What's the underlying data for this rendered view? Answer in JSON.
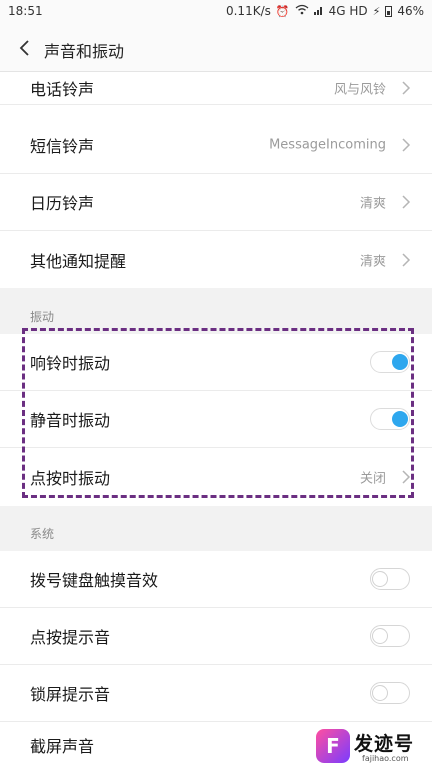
{
  "status_bar": {
    "time": "18:51",
    "speed": "0.11K/s",
    "network": "4G HD",
    "battery": "46%",
    "icons": [
      "alarm-icon",
      "wifi-icon",
      "signal-icon",
      "charging-icon",
      "battery-icon"
    ]
  },
  "header": {
    "title": "声音和振动",
    "back_icon": "chevron-left-icon"
  },
  "ringtones": [
    {
      "label": "电话铃声",
      "value": "风与风铃"
    },
    {
      "label": "短信铃声",
      "value": "MessageIncoming"
    },
    {
      "label": "日历铃声",
      "value": "清爽"
    },
    {
      "label": "其他通知提醒",
      "value": "清爽"
    }
  ],
  "vibration": {
    "title": "振动",
    "items": [
      {
        "label": "响铃时振动",
        "toggle": true
      },
      {
        "label": "静音时振动",
        "toggle": true
      },
      {
        "label": "点按时振动",
        "value": "关闭"
      }
    ]
  },
  "system": {
    "title": "系统",
    "items": [
      {
        "label": "拨号键盘触摸音效",
        "toggle": false
      },
      {
        "label": "点按提示音",
        "toggle": false
      },
      {
        "label": "锁屏提示音",
        "toggle": false
      },
      {
        "label": "截屏声音"
      }
    ]
  },
  "colors": {
    "toggle_on": "#2ea7ee",
    "highlight_border": "#6b2f82"
  },
  "watermark": {
    "logo_letter": "F",
    "name": "发迹号",
    "url": "fajihao.com"
  }
}
